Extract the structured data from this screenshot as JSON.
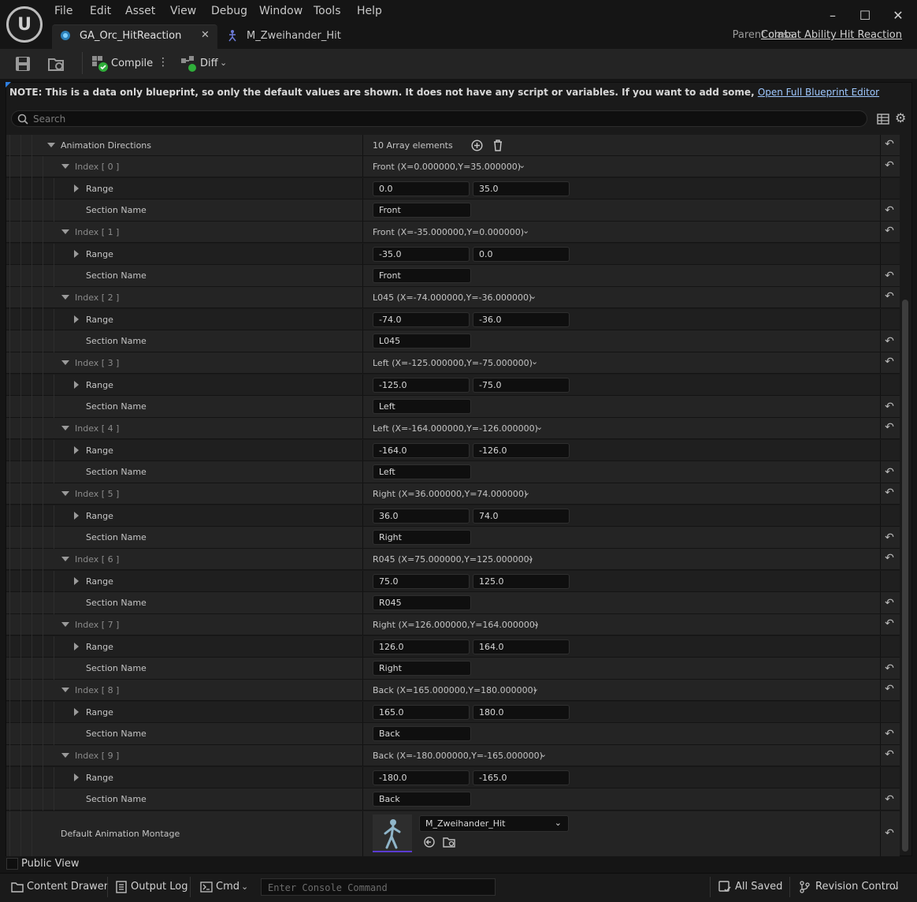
{
  "window": {
    "menu": [
      "File",
      "Edit",
      "Asset",
      "View",
      "Debug",
      "Window",
      "Tools",
      "Help"
    ],
    "tabs": [
      {
        "label": "GA_Orc_HitReaction",
        "active": true
      },
      {
        "label": "M_Zweihander_Hit",
        "active": false
      }
    ],
    "parent_class_label": "Parent class:",
    "parent_class_value": "Combat Ability Hit Reaction"
  },
  "toolbar": {
    "compile_label": "Compile",
    "diff_label": "Diff"
  },
  "notice": {
    "text": "NOTE: This is a data only blueprint, so only the default values are shown.  It does not have any script or variables.  If you want to add some, ",
    "link": "Open Full Blueprint Editor"
  },
  "search": {
    "placeholder": "Search"
  },
  "details": {
    "array_label": "Animation Directions",
    "array_count": "10 Array elements",
    "range_label": "Range",
    "section_label": "Section Name",
    "entries": [
      {
        "index": "Index [ 0 ]",
        "summary": "Front (X=0.000000,Y=35.000000)",
        "x": "0.0",
        "y": "35.0",
        "section": "Front"
      },
      {
        "index": "Index [ 1 ]",
        "summary": "Front (X=-35.000000,Y=0.000000)",
        "x": "-35.0",
        "y": "0.0",
        "section": "Front"
      },
      {
        "index": "Index [ 2 ]",
        "summary": "L045 (X=-74.000000,Y=-36.000000)",
        "x": "-74.0",
        "y": "-36.0",
        "section": "L045"
      },
      {
        "index": "Index [ 3 ]",
        "summary": "Left (X=-125.000000,Y=-75.000000)",
        "x": "-125.0",
        "y": "-75.0",
        "section": "Left"
      },
      {
        "index": "Index [ 4 ]",
        "summary": "Left (X=-164.000000,Y=-126.000000)",
        "x": "-164.0",
        "y": "-126.0",
        "section": "Left"
      },
      {
        "index": "Index [ 5 ]",
        "summary": "Right (X=36.000000,Y=74.000000)",
        "x": "36.0",
        "y": "74.0",
        "section": "Right"
      },
      {
        "index": "Index [ 6 ]",
        "summary": "R045 (X=75.000000,Y=125.000000)",
        "x": "75.0",
        "y": "125.0",
        "section": "R045"
      },
      {
        "index": "Index [ 7 ]",
        "summary": "Right (X=126.000000,Y=164.000000)",
        "x": "126.0",
        "y": "164.0",
        "section": "Right"
      },
      {
        "index": "Index [ 8 ]",
        "summary": "Back (X=165.000000,Y=180.000000)",
        "x": "165.0",
        "y": "180.0",
        "section": "Back"
      },
      {
        "index": "Index [ 9 ]",
        "summary": "Back (X=-180.000000,Y=-165.000000)",
        "x": "-180.0",
        "y": "-165.0",
        "section": "Back"
      }
    ],
    "montage_label": "Default Animation Montage",
    "montage_value": "M_Zweihander_Hit"
  },
  "public_view_label": "Public View",
  "statusbar": {
    "content_drawer": "Content Drawer",
    "output_log": "Output Log",
    "cmd": "Cmd",
    "console_placeholder": "Enter Console Command",
    "saved": "All Saved",
    "revision": "Revision Control"
  }
}
